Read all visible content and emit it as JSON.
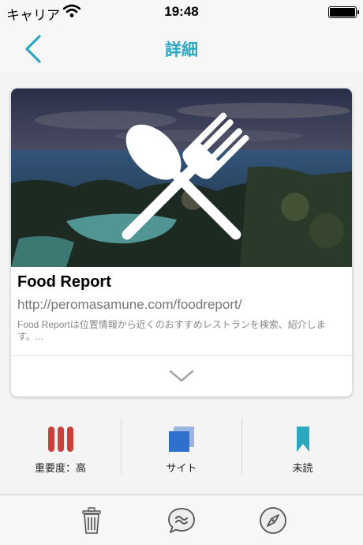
{
  "status_bar": {
    "carrier": "キャリア",
    "time": "19:48",
    "battery_level": 1.0
  },
  "nav": {
    "title": "詳細",
    "back_icon": "chevron-left-icon"
  },
  "card": {
    "title": "Food Report",
    "url": "http://peromasamune.com/foodreport/",
    "description": "Food Reportは位置情報から近くのおすすめレストランを検索、紹介します。...",
    "hero_icon": "fork-spoon-icon",
    "expand_icon": "chevron-down-icon"
  },
  "actions": [
    {
      "label": "重要度：高",
      "icon": "priority-bars-icon",
      "color": "#c9413a"
    },
    {
      "label": "サイト",
      "icon": "site-squares-icon",
      "color": "#2f6fce"
    },
    {
      "label": "未読",
      "icon": "bookmark-icon",
      "color": "#2ba7bf"
    }
  ],
  "toolbar": {
    "items": [
      "trash-icon",
      "chat-icon",
      "compass-icon"
    ]
  },
  "colors": {
    "accent": "#2ba7bf",
    "priority": "#c9413a",
    "site": "#2f6fce"
  }
}
